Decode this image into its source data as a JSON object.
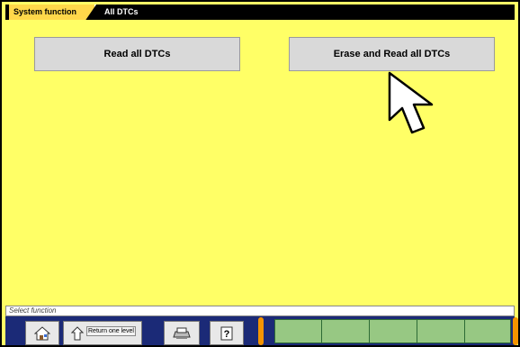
{
  "breadcrumb": {
    "root": "System function",
    "current": "All DTCs"
  },
  "buttons": {
    "read_all": "Read all DTCs",
    "erase_read_all": "Erase and Read all DTCs"
  },
  "status_bar": {
    "text": "Select function"
  },
  "toolbar": {
    "return_label": "Return one level"
  },
  "icons": [
    "home-icon",
    "return-one-level-icon",
    "printer-icon",
    "help-icon",
    "mouse-pointer-icon"
  ],
  "colors": {
    "background": "#ffff66",
    "button": "#d9d9d9",
    "toolbar": "#1b2a77",
    "accent_orange": "#f49400",
    "function_keys": "#97c883"
  }
}
